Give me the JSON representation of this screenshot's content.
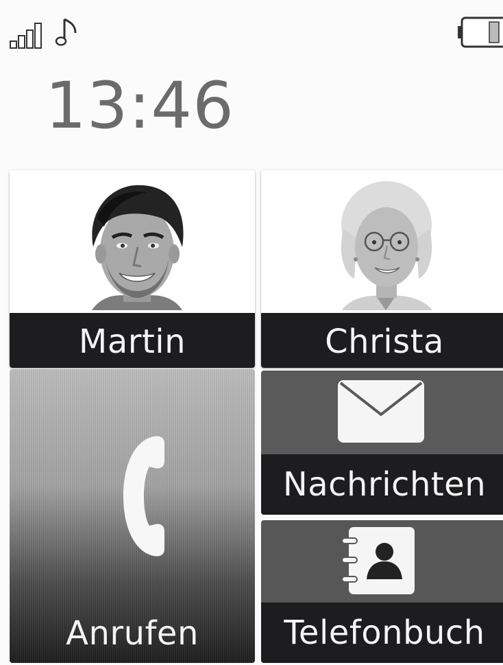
{
  "status_bar": {
    "signal_icon": "signal-strength-icon",
    "ringtone_icon": "music-note-icon",
    "battery_icon": "battery-icon"
  },
  "clock": {
    "time": "13:46"
  },
  "tiles": {
    "martin": {
      "label": "Martin",
      "photo": "man-portrait"
    },
    "christa": {
      "label": "Christa",
      "photo": "senior-woman-portrait"
    },
    "call": {
      "label": "Anrufen",
      "icon": "phone-handset-icon"
    },
    "messages": {
      "label": "Nachrichten",
      "icon": "envelope-icon"
    },
    "phonebook": {
      "label": "Telefonbuch",
      "icon": "address-book-icon"
    }
  },
  "colors": {
    "label_bar": "#1d1c1e",
    "label_text": "#f4f4f4",
    "clock_text": "#6b6b6b",
    "tile_gray": "#5a5a5a"
  }
}
